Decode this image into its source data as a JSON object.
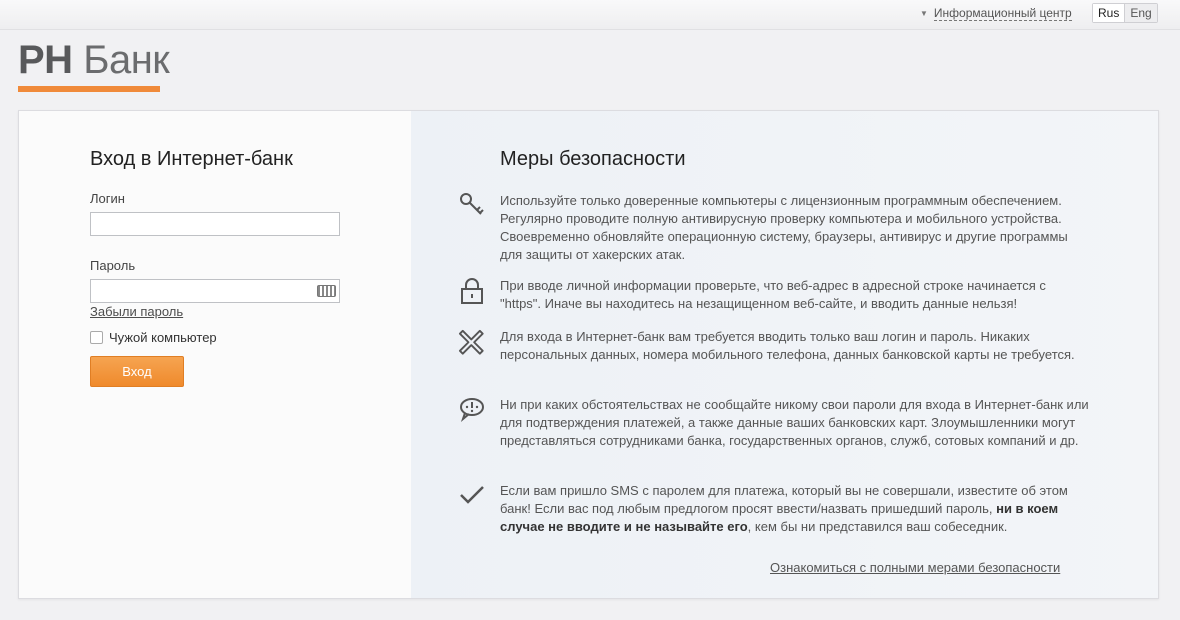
{
  "topbar": {
    "info_center": "Информационный центр",
    "lang_active": "Rus",
    "lang_inactive": "Eng"
  },
  "logo": {
    "rn": "РН",
    "bank": "Банк"
  },
  "login": {
    "title": "Вход в Интернет-банк",
    "login_label": "Логин",
    "login_value": "",
    "password_label": "Пароль",
    "password_value": "",
    "forgot_link": "Забыли пароль",
    "foreign_computer": "Чужой компьютер",
    "submit": "Вход"
  },
  "security": {
    "title": "Меры безопасности",
    "tips": [
      {
        "icon": "key-icon",
        "text": "Используйте только доверенные компьютеры с лицензионным программным обеспечением. Регулярно проводите полную антивирусную проверку компьютера и мобильного устройства. Своевременно обновляйте операционную систему, браузеры, антивирус и другие программы для защиты от хакерских атак."
      },
      {
        "icon": "lock-icon",
        "text": "При вводе личной информации проверьте, что веб-адрес в адресной строке начинается с \"https\". Иначе вы находитесь на незащищенном веб-сайте, и вводить данные нельзя!"
      },
      {
        "icon": "cross-icon",
        "text": "Для входа в Интернет-банк вам требуется вводить только ваш логин и пароль. Никаких персональных данных, номера мобильного телефона, данных банковской карты не требуется."
      },
      {
        "icon": "speech-alert-icon",
        "text": "Ни при каких обстоятельствах не сообщайте никому свои пароли для входа в Интернет-банк или для подтверждения платежей, а также данные ваших банковских карт. Злоумышленники могут представляться сотрудниками банка, государственных органов, служб, сотовых компаний и др."
      },
      {
        "icon": "check-icon",
        "text_before": "Если вам пришло SMS с паролем для платежа, который вы не совершали, известите об этом банк! Если вас под любым предлогом просят ввести/назвать пришедший пароль, ",
        "text_bold": "ни в коем случае не вводите и не называйте его",
        "text_after": ", кем бы ни представился ваш собеседник."
      }
    ],
    "full_link": "Ознакомиться с полными мерами безопасности"
  },
  "colors": {
    "accent": "#ef8a2c",
    "logo_text": "#58595b"
  }
}
